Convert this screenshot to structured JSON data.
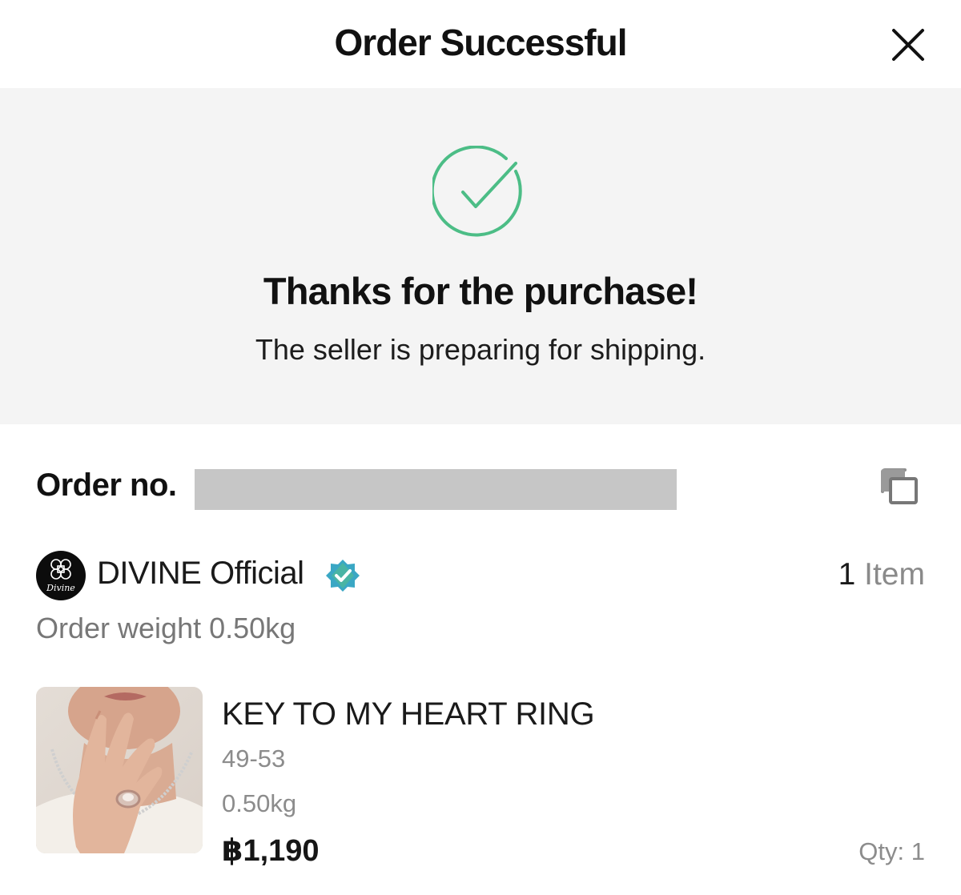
{
  "header": {
    "title": "Order Successful",
    "close_icon": "close-icon"
  },
  "banner": {
    "icon": "check-circle-icon",
    "icon_color": "#4cbd86",
    "title": "Thanks for the purchase!",
    "subtitle": "The seller is preparing for shipping."
  },
  "order": {
    "number_label": "Order no.",
    "copy_icon": "copy-icon"
  },
  "shop": {
    "logo_text": "Divine",
    "name": "DIVINE Official",
    "verified_icon": "verified-badge-icon",
    "verified_color": "#3aa7c4",
    "item_count": "1",
    "item_label": "Item",
    "order_weight": "Order weight 0.50kg"
  },
  "product": {
    "name": "KEY TO MY HEART RING",
    "variant": "49-53",
    "weight": "0.50kg",
    "price": "฿1,190",
    "qty": "Qty: 1"
  }
}
